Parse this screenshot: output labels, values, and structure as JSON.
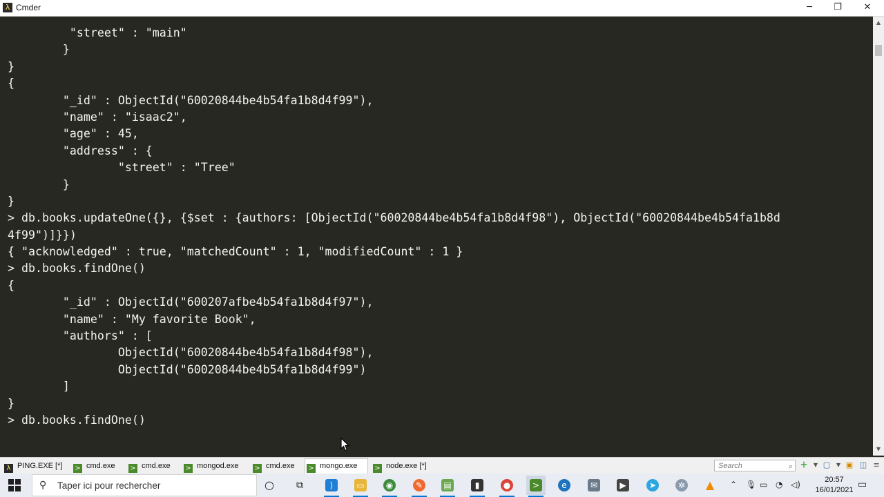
{
  "window": {
    "title": "Cmder",
    "minimize_glyph": "─",
    "maximize_glyph": "❐",
    "close_glyph": "✕"
  },
  "console": {
    "lines": [
      "         \"street\" : \"main\"",
      "        }",
      "}",
      "{",
      "        \"_id\" : ObjectId(\"60020844be4b54fa1b8d4f99\"),",
      "        \"name\" : \"isaac2\",",
      "        \"age\" : 45,",
      "        \"address\" : {",
      "                \"street\" : \"Tree\"",
      "        }",
      "}",
      "> db.books.updateOne({}, {$set : {authors: [ObjectId(\"60020844be4b54fa1b8d4f98\"), ObjectId(\"60020844be4b54fa1b8d",
      "4f99\")]}})",
      "{ \"acknowledged\" : true, \"matchedCount\" : 1, \"modifiedCount\" : 1 }",
      "> db.books.findOne()",
      "{",
      "        \"_id\" : ObjectId(\"600207afbe4b54fa1b8d4f97\"),",
      "        \"name\" : \"My favorite Book\",",
      "        \"authors\" : [",
      "                ObjectId(\"60020844be4b54fa1b8d4f98\"),",
      "                ObjectId(\"60020844be4b54fa1b8d4f99\")",
      "        ]",
      "}",
      "> db.books.findOne()"
    ]
  },
  "tabs": [
    {
      "label": "PING.EXE [*]",
      "icon": "lambda-icon"
    },
    {
      "label": "cmd.exe",
      "icon": "console-icon"
    },
    {
      "label": "cmd.exe",
      "icon": "console-icon"
    },
    {
      "label": "mongod.exe",
      "icon": "console-icon"
    },
    {
      "label": "cmd.exe",
      "icon": "console-icon"
    },
    {
      "label": "mongo.exe",
      "icon": "console-icon",
      "active": true
    },
    {
      "label": "node.exe [*]",
      "icon": "console-icon"
    }
  ],
  "tabbar_search": {
    "placeholder": "Search",
    "icon": "search-icon"
  },
  "taskbar": {
    "search_placeholder": "Taper ici pour rechercher",
    "time": "20:57",
    "date": "16/01/2021"
  },
  "colors": {
    "console_bg": "#272822",
    "console_fg": "#f4f4ef",
    "tabbar_bg": "#f0f0f0",
    "taskbar_bg": "#e9ecf2"
  }
}
